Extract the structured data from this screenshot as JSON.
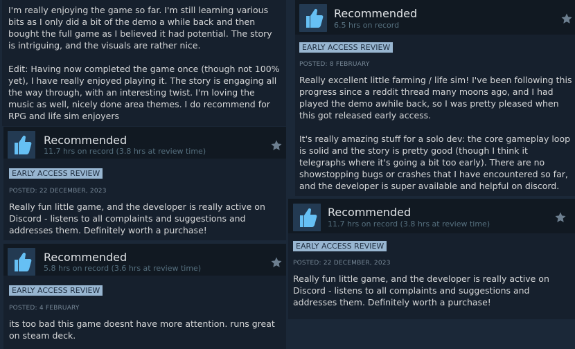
{
  "top_left_review": {
    "paragraphs": [
      "I'm really enjoying the game so far. I'm still learning various bits as I only did a bit of the demo a while back and then bought the full game as I believed it had potential. The story is intriguing, and the visuals are rather nice.",
      "Edit: Having now completed the game once (though not 100% yet), I have really enjoyed playing it. The story is engaging all the way through, with an interesting twist. I'm loving the music as well, nicely done area themes. I do recommend for RPG and life sim enjoyers"
    ]
  },
  "review_a": {
    "verdict": "Recommended",
    "hours": "11.7 hrs on record (3.8 hrs at review time)",
    "badge": "EARLY ACCESS REVIEW",
    "posted": "POSTED: 22 DECEMBER, 2023",
    "text": "Really fun little game, and the developer is really active on Discord - listens to all complaints and suggestions and addresses them. Definitely worth a purchase!"
  },
  "review_b": {
    "verdict": "Recommended",
    "hours": "5.8 hrs on record (3.6 hrs at review time)",
    "badge": "EARLY ACCESS REVIEW",
    "posted": "POSTED: 4 FEBRUARY",
    "text": "its too bad this game doesnt have more attention. runs great on steam deck."
  },
  "review_c": {
    "verdict": "Recommended",
    "hours": "6.5 hrs on record",
    "badge": "EARLY ACCESS REVIEW",
    "posted": "POSTED: 8 FEBRUARY",
    "paragraphs": [
      "Really excellent little farming / life sim! I've been following this progress since a reddit thread many moons ago, and I had played the demo awhile back, so I was pretty pleased when this got released early access.",
      "It's really amazing stuff for a solo dev: the core gameplay loop is solid and the story is pretty good (though I think it telegraphs where it's going a bit too early). There are no showstopping bugs or crashes that I have encountered so far, and the developer is super available and helpful on discord."
    ]
  },
  "review_d": {
    "verdict": "Recommended",
    "hours": "11.7 hrs on record (3.8 hrs at review time)",
    "badge": "EARLY ACCESS REVIEW",
    "posted": "POSTED: 22 DECEMBER, 2023",
    "text": "Really fun little game, and the developer is really active on Discord - listens to all complaints and suggestions and addresses them. Definitely worth a purchase!"
  },
  "icons": {
    "thumb": "thumbs-up-icon",
    "award": "award-star-icon"
  },
  "colors": {
    "page_bg": "#1b2838",
    "card_bg": "#16202d",
    "header_bg": "#111922",
    "badge_bg": "#98b6d1",
    "thumb_blue": "#66c0f4"
  }
}
